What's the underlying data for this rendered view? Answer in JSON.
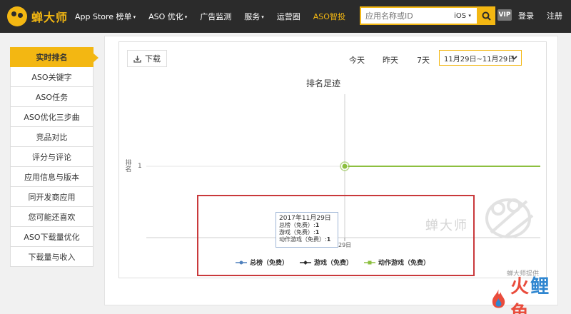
{
  "app": {
    "logo_text": "蝉大师"
  },
  "nav": {
    "items": [
      {
        "label": "App Store 榜单",
        "dropdown": true
      },
      {
        "label": "ASO 优化",
        "dropdown": true
      },
      {
        "label": "广告监测",
        "dropdown": false
      },
      {
        "label": "服务",
        "dropdown": true
      },
      {
        "label": "运营圈",
        "dropdown": false
      },
      {
        "label": "ASO智投",
        "dropdown": false,
        "active": true
      }
    ],
    "caret": "▾"
  },
  "search": {
    "placeholder": "应用名称或ID",
    "platform": "iOS",
    "platform_caret": "▾"
  },
  "header_right": {
    "vip": "VIP",
    "login": "登录",
    "register": "注册"
  },
  "sidebar": {
    "items": [
      {
        "label": "实时排名",
        "active": true
      },
      {
        "label": "ASO关键字"
      },
      {
        "label": "ASO任务"
      },
      {
        "label": "ASO优化三步曲"
      },
      {
        "label": "竞品对比"
      },
      {
        "label": "评分与评论"
      },
      {
        "label": "应用信息与版本"
      },
      {
        "label": "同开发商应用"
      },
      {
        "label": "您可能还喜欢"
      },
      {
        "label": "ASO下载量优化"
      },
      {
        "label": "下载量与收入"
      }
    ]
  },
  "toolbar": {
    "download_label": "下载",
    "range_today": "今天",
    "range_yesterday": "昨天",
    "range_7days": "7天",
    "date_range": "11月29日~11月29日"
  },
  "chart_data": {
    "type": "line",
    "title": "排名足迹",
    "ylabel": "排名",
    "y_ticks": [
      "1"
    ],
    "x_ticks": [
      "29日"
    ],
    "series": [
      {
        "name": "总榜（免费）",
        "values": [],
        "color": "#4f81bd"
      },
      {
        "name": "游戏（免费）",
        "values": [],
        "color": "#2b2b2b"
      },
      {
        "name": "动作游戏（免费）",
        "values": [
          1
        ],
        "color": "#8cbf3f"
      }
    ],
    "tooltip": {
      "date": "2017年11月29日",
      "rows": [
        {
          "label": "总榜（免费）:",
          "value": "1"
        },
        {
          "label": "游戏（免费）:",
          "value": "1"
        },
        {
          "label": "动作游戏（免费）:",
          "value": "1"
        }
      ]
    },
    "credit": "蝉大师提供",
    "watermark": "蝉大师"
  },
  "brand": {
    "c1": "火",
    "c2": "鲤",
    "c3": "鱼"
  },
  "colors": {
    "accent": "#f3b712",
    "nav_bg": "#2b2b2b",
    "highlight": "#c9393b"
  }
}
